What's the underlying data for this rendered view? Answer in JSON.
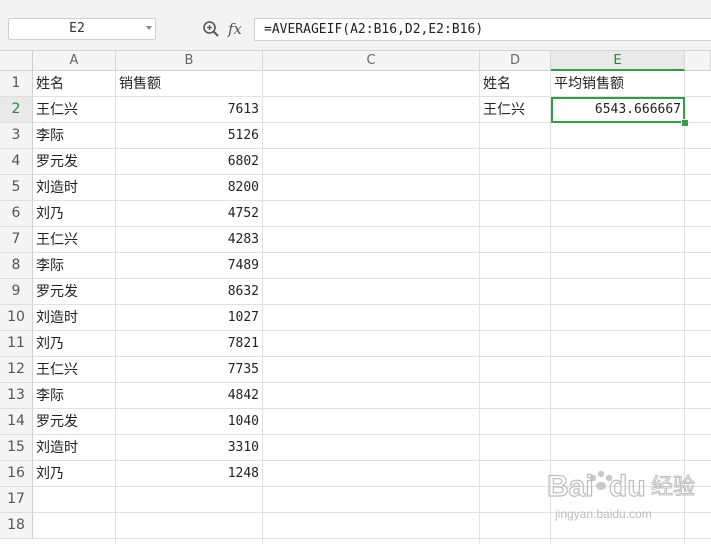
{
  "formula_bar": {
    "name_box": "E2",
    "fx_label": "fx",
    "formula": "=AVERAGEIF(A2:B16,D2,E2:B16)"
  },
  "columns": [
    "A",
    "B",
    "C",
    "D",
    "E"
  ],
  "rows": [
    "1",
    "2",
    "3",
    "4",
    "5",
    "6",
    "7",
    "8",
    "9",
    "10",
    "11",
    "12",
    "13",
    "14",
    "15",
    "16",
    "17",
    "18"
  ],
  "sheet": {
    "A": [
      "姓名",
      "王仁兴",
      "李际",
      "罗元发",
      "刘造时",
      "刘乃",
      "王仁兴",
      "李际",
      "罗元发",
      "刘造时",
      "刘乃",
      "王仁兴",
      "李际",
      "罗元发",
      "刘造时",
      "刘乃"
    ],
    "B": [
      "销售额",
      "7613",
      "5126",
      "6802",
      "8200",
      "4752",
      "4283",
      "7489",
      "8632",
      "1027",
      "7821",
      "7735",
      "4842",
      "1040",
      "3310",
      "1248"
    ],
    "D1": "姓名",
    "E1": "平均销售额",
    "D2": "王仁兴",
    "E2": "6543.666667"
  },
  "selection": {
    "active_cell": "E2",
    "accent_color": "#2f9e48"
  },
  "watermark": {
    "brand": "Bai",
    "brand2": "经验",
    "url": "jingyan.baidu.com"
  }
}
